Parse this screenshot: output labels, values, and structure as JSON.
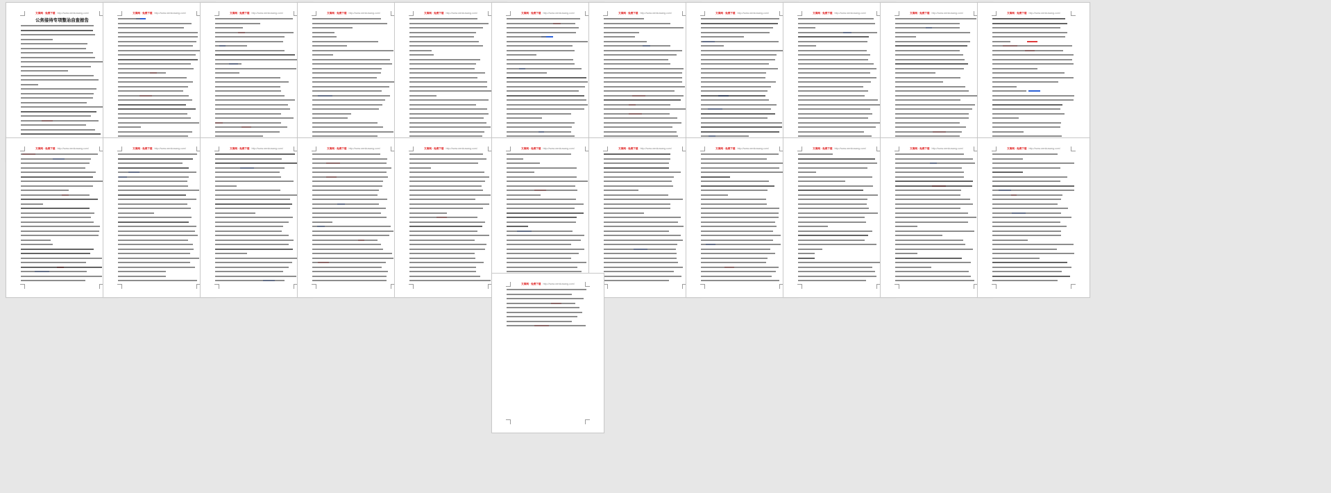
{
  "document": {
    "title": "公务接待专项整治自查报告",
    "page_count": 23,
    "header": {
      "brand": "文库网 · 免费下载",
      "url": "http://www.wenkuwang.com/"
    }
  },
  "colors": {
    "background": "#e7e7e7",
    "page": "#ffffff",
    "text": "#6f6f6f",
    "header_brand": "#e02020",
    "header_url": "#888888",
    "highlight_red": "#e03a3a",
    "highlight_blue": "#2a5fd6"
  }
}
